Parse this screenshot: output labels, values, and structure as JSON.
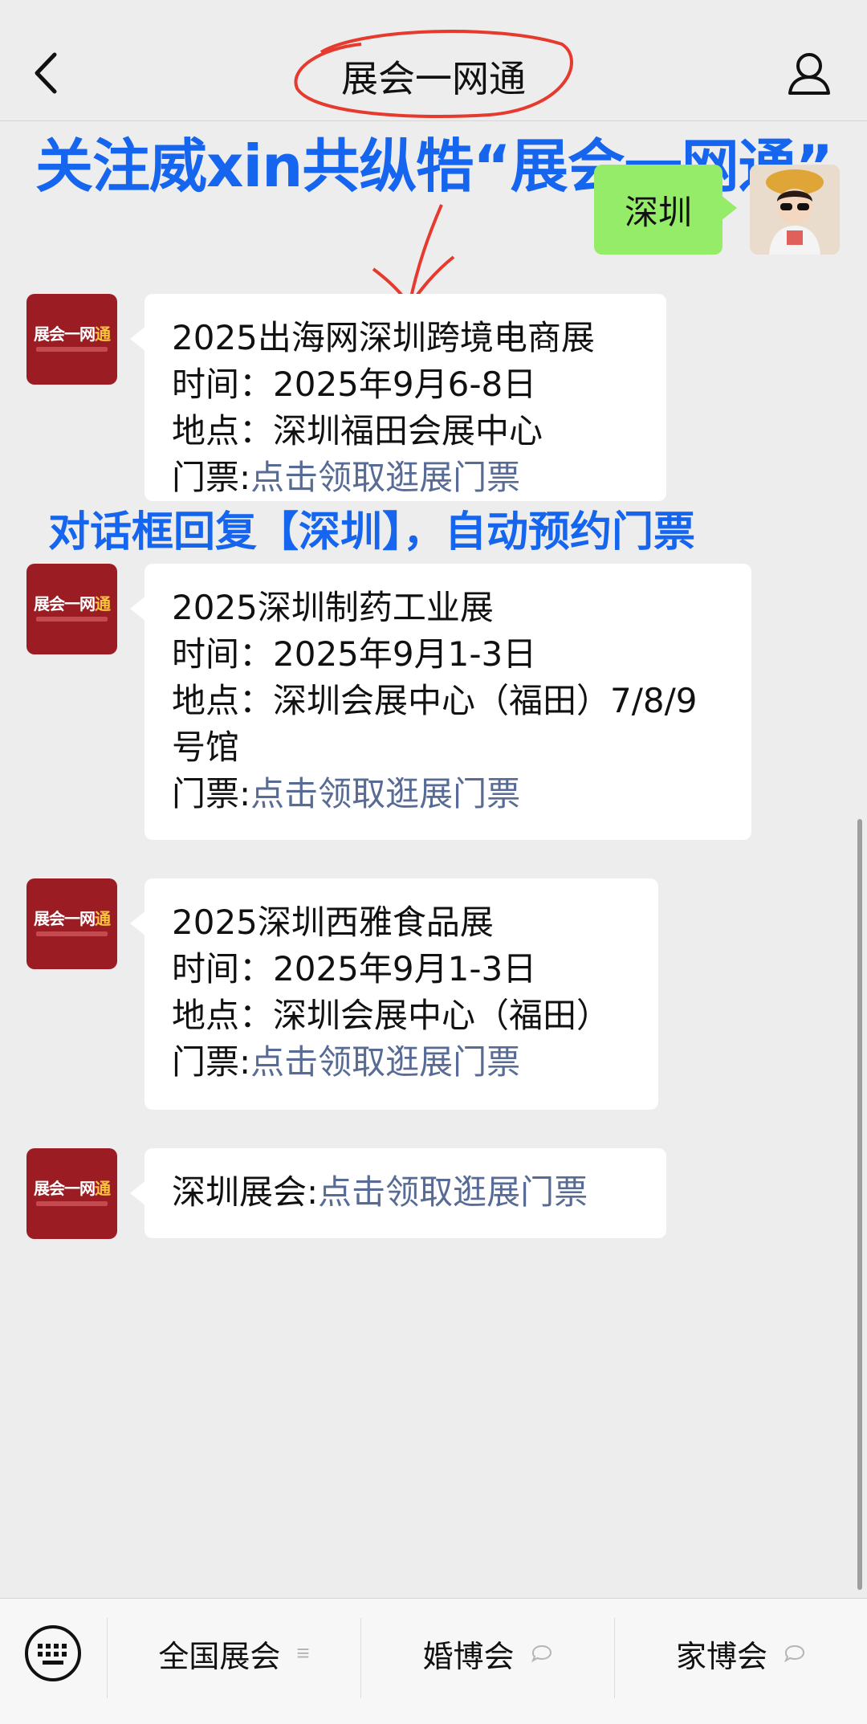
{
  "header": {
    "title": "展会一网通"
  },
  "overlays": {
    "top_text": "关注威xin共纵牿“展会一网通”",
    "middle_text": "对话框回复【深圳】，自动预约门票"
  },
  "user_message": {
    "text": "深圳"
  },
  "avatar_logo": "展会一网通",
  "messages": [
    {
      "title": "2025出海网深圳跨境电商展",
      "time_label": "时间：",
      "time": "2025年9月6-8日",
      "place_label": "地点：",
      "place": "深圳福田会展中心",
      "ticket_label": "门票:",
      "ticket_link": "点击领取逛展门票"
    },
    {
      "title": "2025深圳制药工业展",
      "time_label": "时间：",
      "time": "2025年9月1-3日",
      "place_label": "地点：",
      "place": "深圳会展中心（福田）7/8/9",
      "place_cont": "号馆",
      "ticket_label": "门票:",
      "ticket_link": "点击领取逛展门票"
    },
    {
      "title": "2025深圳西雅食品展",
      "time_label": "时间：",
      "time": "2025年9月1-3日",
      "place_label": "地点：",
      "place": "深圳会展中心（福田）",
      "ticket_label": "门票:",
      "ticket_link": "点击领取逛展门票"
    },
    {
      "label": "深圳展会:",
      "link": "点击领取逛展门票"
    }
  ],
  "bottom_menu": [
    {
      "label": "全国展会",
      "icon": "list-icon"
    },
    {
      "label": "婚博会",
      "icon": "chat-bubble-icon"
    },
    {
      "label": "家博会",
      "icon": "chat-bubble-icon"
    }
  ],
  "colors": {
    "overlay_blue": "#1565ef",
    "link": "#576b95",
    "user_bubble": "#95ec69",
    "logo_red": "#9b1c22"
  }
}
